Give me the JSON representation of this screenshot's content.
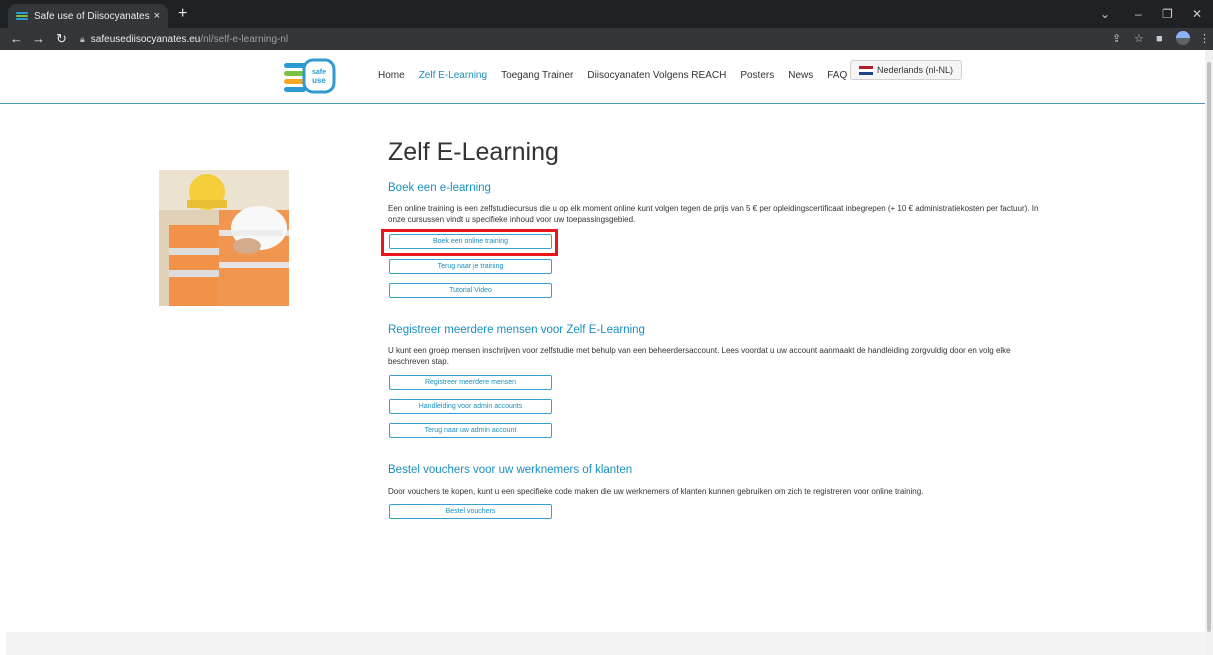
{
  "browser": {
    "tab_title": "Safe use of Diisocyanates - Zelf E",
    "tab_close": "×",
    "new_tab": "+",
    "url_host": "safeusediisocyanates.eu",
    "url_path": "/nl/self-e-learning-nl"
  },
  "site": {
    "logo_text_top": "safe",
    "logo_text_bottom": "use",
    "nav": [
      "Home",
      "Zelf E-Learning",
      "Toegang Trainer",
      "Diisocyanaten Volgens REACH",
      "Posters",
      "News",
      "FAQ"
    ],
    "active_nav": 1,
    "language": "Nederlands (nl-NL)"
  },
  "main": {
    "title": "Zelf E-Learning",
    "section1": {
      "heading": "Boek een e-learning",
      "text": "Een online training is een zelfstudiecursus die u op elk moment online kunt volgen tegen de prijs van 5 € per opleidingscertificaat inbegrepen (+ 10 € administratiekosten per factuur). In onze cursussen vindt u specifieke inhoud voor uw toepassingsgebied.",
      "buttons": [
        "Boek een online training",
        "Terug naar je training",
        "Tutorial Video"
      ]
    },
    "section2": {
      "heading": "Registreer meerdere mensen voor Zelf E-Learning",
      "text": "U kunt een groep mensen inschrijven voor zelfstudie met behulp van een beheerdersaccount. Lees voordat u uw account aanmaakt de handleiding zorgvuldig door en volg elke beschreven stap.",
      "buttons": [
        "Registreer meerdere mensen",
        "Handleiding voor admin accounts",
        "Terug naar uw admin account"
      ]
    },
    "section3": {
      "heading": "Bestel vouchers voor uw werknemers of klanten",
      "text": "Door vouchers te kopen, kunt u een specifieke code maken die uw werknemers of klanten kunnen gebruiken om zich te registreren voor online training.",
      "buttons": [
        "Bestel vouchers"
      ]
    }
  },
  "colors": {
    "accent": "#1a8fbf",
    "highlight": "#e8161b",
    "chrome_dark": "#202124"
  }
}
